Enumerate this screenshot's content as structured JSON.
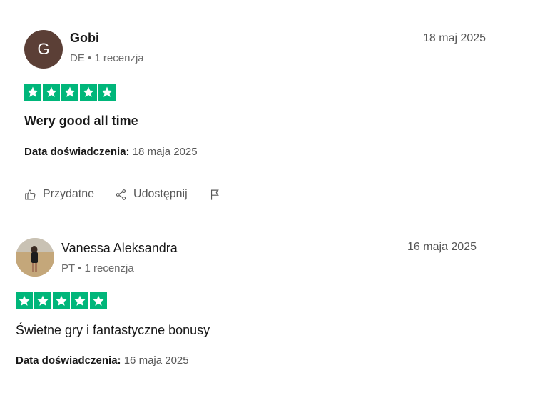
{
  "reviews": [
    {
      "initial": "G",
      "name": "Gobi",
      "meta": "DE • 1 recenzja",
      "date": "18 maj 2025",
      "rating": 5,
      "title": "Wery good all time",
      "experience_label": "Data doświadczenia:",
      "experience_value": "18 maja 2025",
      "actions": {
        "helpful": "Przydatne",
        "share": "Udostępnij"
      }
    },
    {
      "name": "Vanessa Aleksandra",
      "meta": "PT • 1 recenzja",
      "date": "16 maja 2025",
      "rating": 5,
      "title": "Świetne gry i fantastyczne bonusy",
      "experience_label": "Data doświadczenia:",
      "experience_value": "16 maja 2025"
    }
  ],
  "colors": {
    "star_green": "#00b67a",
    "avatar_brown": "#5b3f36"
  },
  "icons": [
    "thumbs-up-icon",
    "share-icon",
    "flag-icon",
    "star-icon"
  ]
}
